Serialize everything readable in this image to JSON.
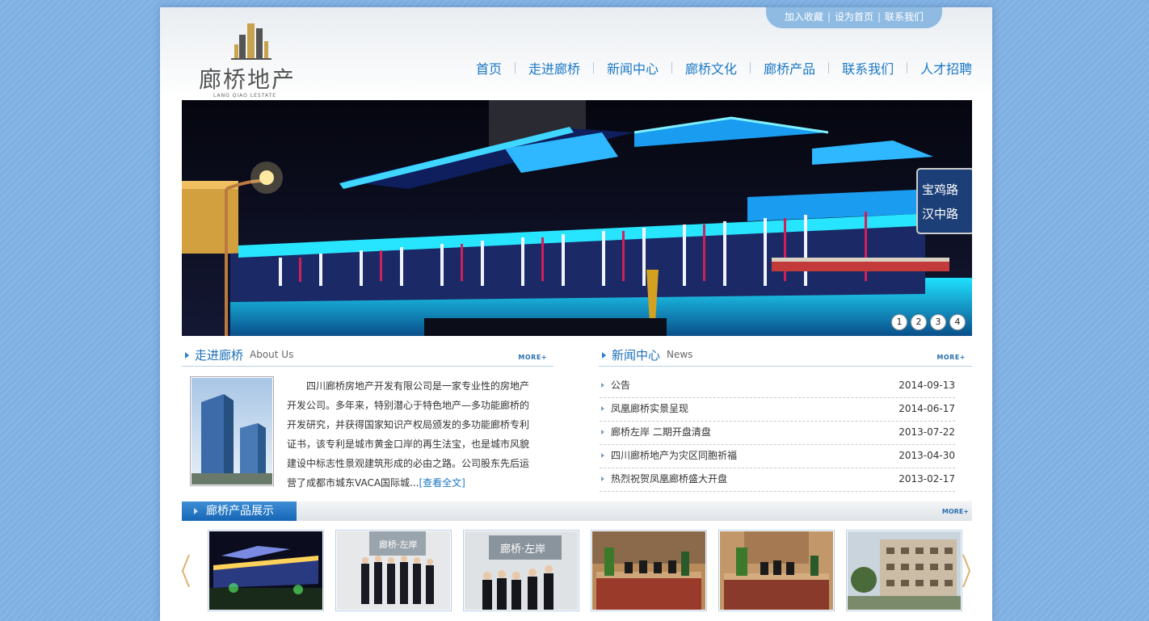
{
  "toplinks": [
    "加入收藏",
    "设为首页",
    "联系我们"
  ],
  "logo": {
    "name": "廊桥地产",
    "sub": "LANG QIAO LESTATE"
  },
  "nav": [
    "首页",
    "走进廊桥",
    "新闻中心",
    "廊桥文化",
    "廊桥产品",
    "联系我们",
    "人才招聘"
  ],
  "banner": {
    "sign_lines": [
      "宝鸡路",
      "汉中路"
    ],
    "dots": [
      "1",
      "2",
      "3",
      "4"
    ]
  },
  "about": {
    "title": "走进廊桥",
    "title_en": "About Us",
    "more": "MORE+",
    "text": "四川廊桥房地产开发有限公司是一家专业性的房地产开发公司。多年来，特别潜心于特色地产—多功能廊桥的开发研究，并获得国家知识产权局颁发的多功能廊桥专利证书，该专利是城市黄金口岸的再生法宝，也是城市风貌建设中标志性景观建筑形成的必由之路。公司股东先后运营了成都市城东VACA国际城...",
    "readmore": "[查看全文]"
  },
  "news": {
    "title": "新闻中心",
    "title_en": "News",
    "more": "MORE+",
    "items": [
      {
        "title": "公告",
        "date": "2014-09-13"
      },
      {
        "title": "凤凰廊桥实景呈现",
        "date": "2014-06-17"
      },
      {
        "title": "廊桥左岸 二期开盘清盘",
        "date": "2013-07-22"
      },
      {
        "title": "四川廊桥地产为灾区同胞祈福",
        "date": "2013-04-30"
      },
      {
        "title": "热烈祝贺凤凰廊桥盛大开盘",
        "date": "2013-02-17"
      }
    ]
  },
  "products": {
    "title": "廊桥产品展示",
    "more": "MORE+",
    "sign": "廊桥·左岸"
  },
  "colors": {
    "accent": "#1b78c5",
    "bar": "#1565b6",
    "nav": "#1b78c5",
    "arrow": "#e0b070"
  }
}
